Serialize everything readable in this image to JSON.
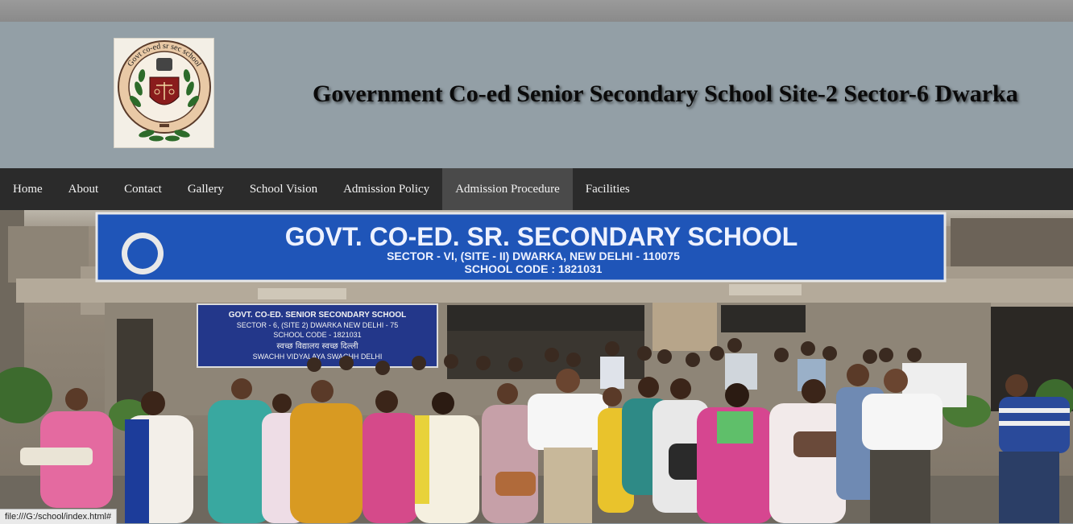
{
  "header": {
    "title": "Government Co-ed Senior Secondary School Site-2 Sector-6 Dwarka",
    "logo": {
      "ring_text": "Govt co-ed sr sec school",
      "icon": "school-emblem-logo"
    }
  },
  "nav": {
    "items": [
      {
        "label": "Home",
        "active": false
      },
      {
        "label": "About",
        "active": false
      },
      {
        "label": "Contact",
        "active": false
      },
      {
        "label": "Gallery",
        "active": false
      },
      {
        "label": "School Vision",
        "active": false
      },
      {
        "label": "Admission Policy",
        "active": false
      },
      {
        "label": "Admission Procedure",
        "active": true
      },
      {
        "label": "Facilities",
        "active": false
      }
    ]
  },
  "hero": {
    "main_sign": {
      "line1": "GOVT. CO-ED. SR. SECONDARY SCHOOL",
      "line2": "SECTOR - VI, (SITE - II) DWARKA, NEW DELHI - 110075",
      "line3": "SCHOOL CODE : 1821031"
    },
    "small_sign": {
      "line1": "GOVT. CO-ED. SENIOR SECONDARY SCHOOL",
      "line2": "SECTOR - 6, (SITE 2) DWARKA NEW DELHI - 75",
      "line3": "SCHOOL CODE - 1821031",
      "line4": "स्वच्छ विद्यालय स्वच्छ दिल्ली",
      "line5": "SWACHH VIDYALAYA SWACHH DELHI"
    }
  },
  "statusbar": {
    "url": "file:///G:/school/index.html#"
  },
  "colors": {
    "header_bg": "#939fa6",
    "nav_bg": "#2b2b2b",
    "nav_active_bg": "#4a4a4a",
    "sign_blue": "#1f55b8"
  }
}
